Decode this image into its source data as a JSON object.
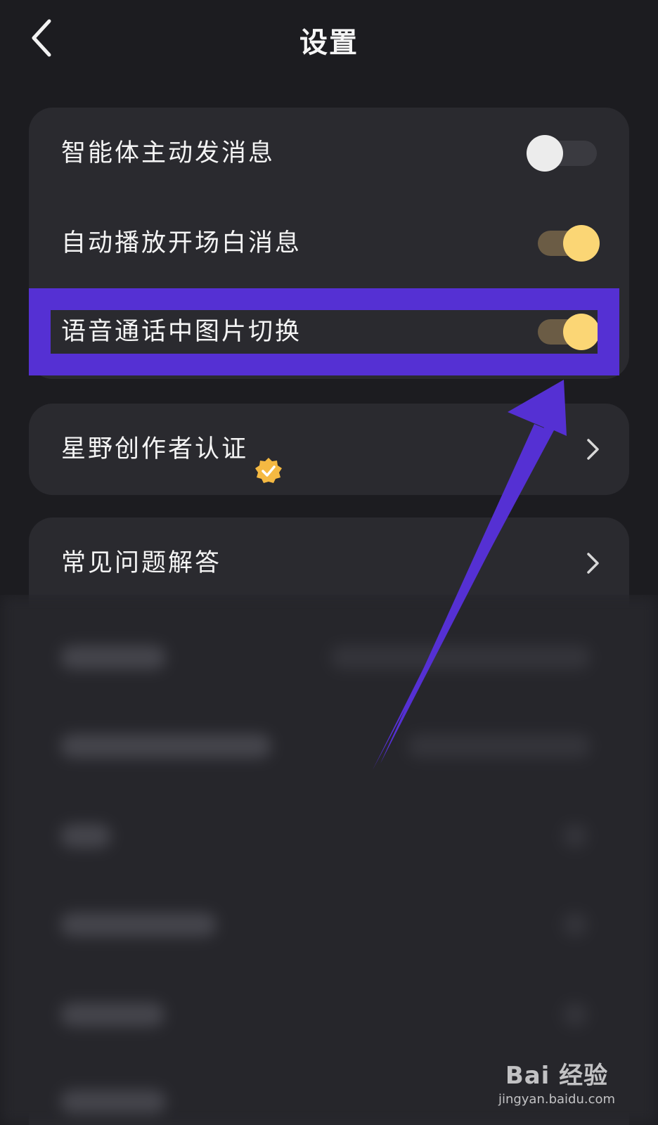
{
  "header": {
    "title": "设置",
    "back_icon": "chevron-left-icon"
  },
  "settings": {
    "toggles": [
      {
        "label": "智能体主动发消息",
        "enabled": false
      },
      {
        "label": "自动播放开场白消息",
        "enabled": true
      },
      {
        "label": "语音通话中图片切换",
        "enabled": true
      }
    ],
    "creator": {
      "label": "星野创作者认证",
      "badge_icon": "verified-badge-icon"
    },
    "faq": {
      "label": "常见问题解答"
    }
  },
  "annotation": {
    "color": "#5530d3",
    "highlighted_item": "语音通话中图片切换"
  },
  "colors": {
    "background": "#1c1c20",
    "card": "#2a2a2f",
    "toggle_on_knob": "#fbd675",
    "toggle_on_track": "#6b5c45",
    "toggle_off_knob": "#ececec",
    "badge": "#f5b942"
  },
  "watermark": {
    "logo": "Bai 经验",
    "url": "jingyan.baidu.com"
  }
}
